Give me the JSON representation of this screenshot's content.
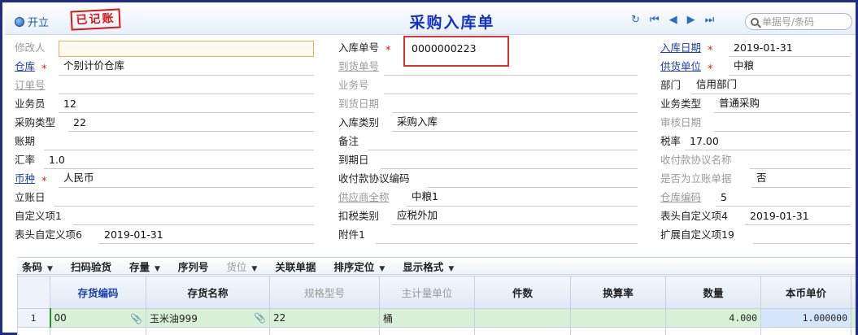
{
  "titlebar": {
    "open_label": "开立",
    "stamp_text": "已记账",
    "title": "采购入库单",
    "search_placeholder": "单据号/条码",
    "nav_icons": [
      "refresh-icon",
      "first-record-icon",
      "prev-record-icon",
      "next-record-icon",
      "last-record-icon"
    ]
  },
  "form": {
    "modifier": {
      "label": "修改人",
      "value": ""
    },
    "receipt_no": {
      "label": "入库单号",
      "value": "0000000223"
    },
    "receipt_date": {
      "label": "入库日期",
      "value": "2019-01-31"
    },
    "warehouse": {
      "label": "仓库",
      "value": "个别计价仓库"
    },
    "arrival_no": {
      "label": "到货单号",
      "value": ""
    },
    "supplier": {
      "label": "供货单位",
      "value": "中粮"
    },
    "order_no": {
      "label": "订单号",
      "value": ""
    },
    "business_no": {
      "label": "业务号",
      "value": ""
    },
    "department": {
      "label": "部门",
      "value": "信用部门"
    },
    "salesperson": {
      "label": "业务员",
      "value": "12"
    },
    "arrival_date": {
      "label": "到货日期",
      "value": ""
    },
    "business_type": {
      "label": "业务类型",
      "value": "普通采购"
    },
    "purchase_type": {
      "label": "采购类型",
      "value": "22"
    },
    "receipt_category": {
      "label": "入库类别",
      "value": "采购入库"
    },
    "audit_date": {
      "label": "审核日期",
      "value": ""
    },
    "account_period": {
      "label": "账期",
      "value": ""
    },
    "remark": {
      "label": "备注",
      "value": ""
    },
    "tax_rate": {
      "label": "税率",
      "value": "17.00"
    },
    "exchange_rate": {
      "label": "汇率",
      "value": "1.0"
    },
    "due_date": {
      "label": "到期日",
      "value": ""
    },
    "payment_agreement_name": {
      "label": "收付款协议名称",
      "value": ""
    },
    "currency": {
      "label": "币种",
      "value": "人民币"
    },
    "payment_agreement_code": {
      "label": "收付款协议编码",
      "value": ""
    },
    "immediate_bill": {
      "label": "是否为立账单据",
      "value": "否"
    },
    "bill_date": {
      "label": "立账日",
      "value": ""
    },
    "supplier_fullname": {
      "label": "供应商全称",
      "value": "中粮1"
    },
    "warehouse_code": {
      "label": "仓库编码",
      "value": "5"
    },
    "custom1": {
      "label": "自定义项1",
      "value": ""
    },
    "tax_deduction_type": {
      "label": "扣税类别",
      "value": "应税外加"
    },
    "header_custom4": {
      "label": "表头自定义项4",
      "value": "2019-01-31"
    },
    "header_custom6": {
      "label": "表头自定义项6",
      "value": "2019-01-31"
    },
    "attachment": {
      "label": "附件1",
      "value": ""
    },
    "ext_custom19": {
      "label": "扩展自定义项19",
      "value": ""
    }
  },
  "toolbar": {
    "items": [
      {
        "label": "条码",
        "caret": true,
        "enabled": true
      },
      {
        "label": "扫码验货",
        "caret": false,
        "enabled": true
      },
      {
        "label": "存量",
        "caret": true,
        "enabled": true
      },
      {
        "label": "序列号",
        "caret": false,
        "enabled": true
      },
      {
        "label": "货位",
        "caret": true,
        "enabled": false
      },
      {
        "label": "关联单据",
        "caret": false,
        "enabled": true
      },
      {
        "label": "排序定位",
        "caret": true,
        "enabled": true
      },
      {
        "label": "显示格式",
        "caret": true,
        "enabled": true
      }
    ]
  },
  "grid": {
    "headers": [
      "存货编码",
      "存货名称",
      "规格型号",
      "主计量单位",
      "件数",
      "换算率",
      "数量",
      "本币单价"
    ],
    "rows": [
      {
        "index": "1",
        "code": "00",
        "name": "玉米油999",
        "spec": "22",
        "unit": "桶",
        "pieces": "",
        "conversion": "",
        "quantity": "4.000",
        "unit_price": "1.000000"
      }
    ]
  }
}
